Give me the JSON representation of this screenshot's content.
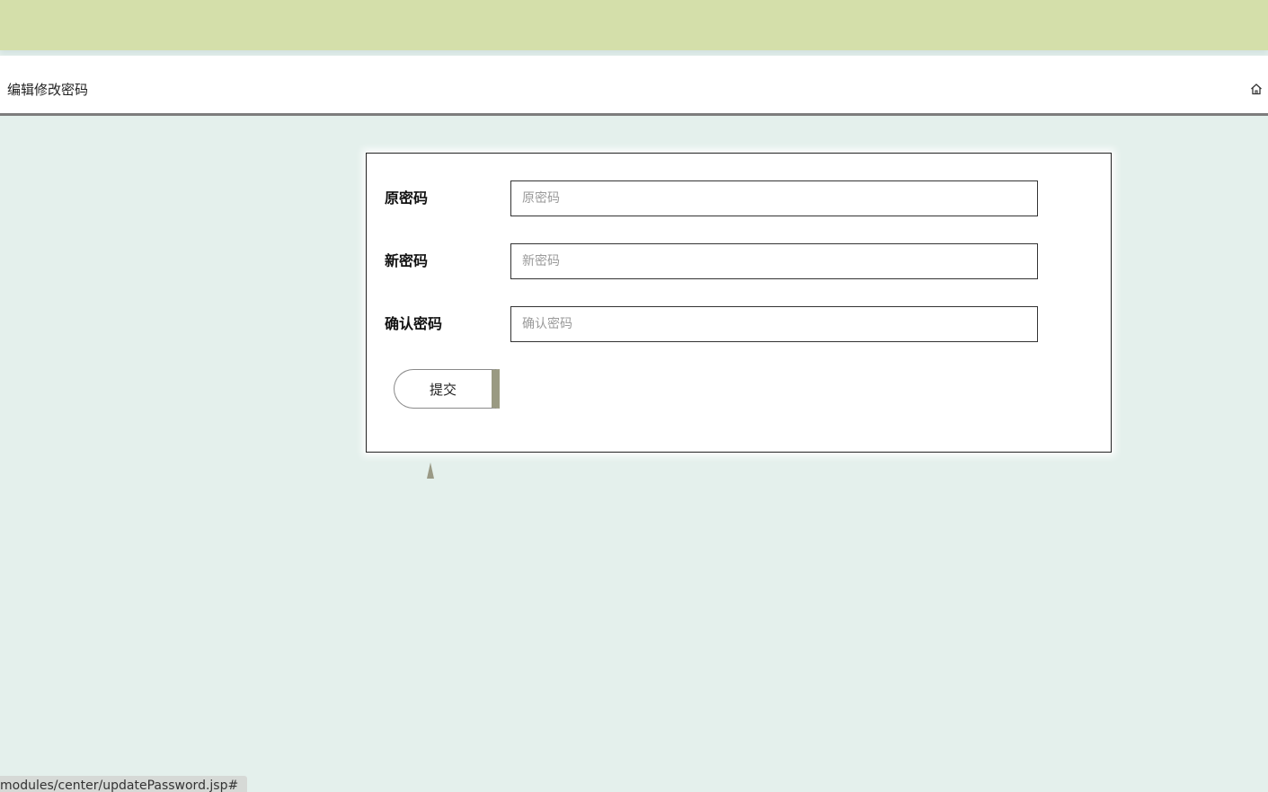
{
  "header": {
    "title": "编辑修改密码",
    "home_icon": "home-icon"
  },
  "form": {
    "fields": [
      {
        "label": "原密码",
        "placeholder": "原密码",
        "value": ""
      },
      {
        "label": "新密码",
        "placeholder": "新密码",
        "value": ""
      },
      {
        "label": "确认密码",
        "placeholder": "确认密码",
        "value": ""
      }
    ],
    "submit_label": "提交"
  },
  "status_bar": {
    "url": "modules/center/updatePassword.jsp#"
  },
  "colors": {
    "top_bar": "#d4dfaa",
    "page_background": "#e4f0ec",
    "header_border": "#7d7d7d"
  }
}
